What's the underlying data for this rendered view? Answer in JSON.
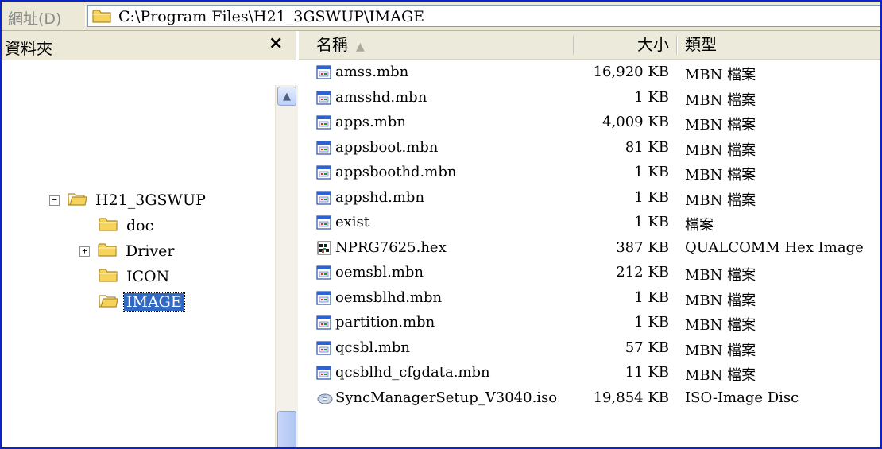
{
  "address": {
    "label": "網址(D)",
    "path": "C:\\Program Files\\H21_3GSWUP\\IMAGE"
  },
  "folders_pane": {
    "title": "資料夾",
    "close": "×",
    "tree": [
      {
        "label": "H21_3GSWUP",
        "expander": "−"
      },
      {
        "label": "doc"
      },
      {
        "label": "Driver",
        "expander": "+"
      },
      {
        "label": "ICON"
      },
      {
        "label": "IMAGE",
        "selected": true
      }
    ]
  },
  "columns": {
    "name": "名稱",
    "size": "大小",
    "type": "類型"
  },
  "files": [
    {
      "name": "amss.mbn",
      "size": "16,920 KB",
      "type": "MBN 檔案",
      "icon": "app-file-icon"
    },
    {
      "name": "amsshd.mbn",
      "size": "1 KB",
      "type": "MBN 檔案",
      "icon": "app-file-icon"
    },
    {
      "name": "apps.mbn",
      "size": "4,009 KB",
      "type": "MBN 檔案",
      "icon": "app-file-icon"
    },
    {
      "name": "appsboot.mbn",
      "size": "81 KB",
      "type": "MBN 檔案",
      "icon": "app-file-icon"
    },
    {
      "name": "appsboothd.mbn",
      "size": "1 KB",
      "type": "MBN 檔案",
      "icon": "app-file-icon"
    },
    {
      "name": "appshd.mbn",
      "size": "1 KB",
      "type": "MBN 檔案",
      "icon": "app-file-icon"
    },
    {
      "name": "exist",
      "size": "1 KB",
      "type": "檔案",
      "icon": "app-file-icon"
    },
    {
      "name": "NPRG7625.hex",
      "size": "387 KB",
      "type": "QUALCOMM Hex Image",
      "icon": "hex-file-icon"
    },
    {
      "name": "oemsbl.mbn",
      "size": "212 KB",
      "type": "MBN 檔案",
      "icon": "app-file-icon"
    },
    {
      "name": "oemsblhd.mbn",
      "size": "1 KB",
      "type": "MBN 檔案",
      "icon": "app-file-icon"
    },
    {
      "name": "partition.mbn",
      "size": "1 KB",
      "type": "MBN 檔案",
      "icon": "app-file-icon"
    },
    {
      "name": "qcsbl.mbn",
      "size": "57 KB",
      "type": "MBN 檔案",
      "icon": "app-file-icon"
    },
    {
      "name": "qcsblhd_cfgdata.mbn",
      "size": "11 KB",
      "type": "MBN 檔案",
      "icon": "app-file-icon"
    },
    {
      "name": "SyncManagerSetup_V3040.iso",
      "size": "19,854 KB",
      "type": "ISO-Image Disc",
      "icon": "disc-image-icon"
    }
  ],
  "colors": {
    "frame": "#0a24c8",
    "selection": "#316ac5",
    "folder": "#f6d35c"
  }
}
